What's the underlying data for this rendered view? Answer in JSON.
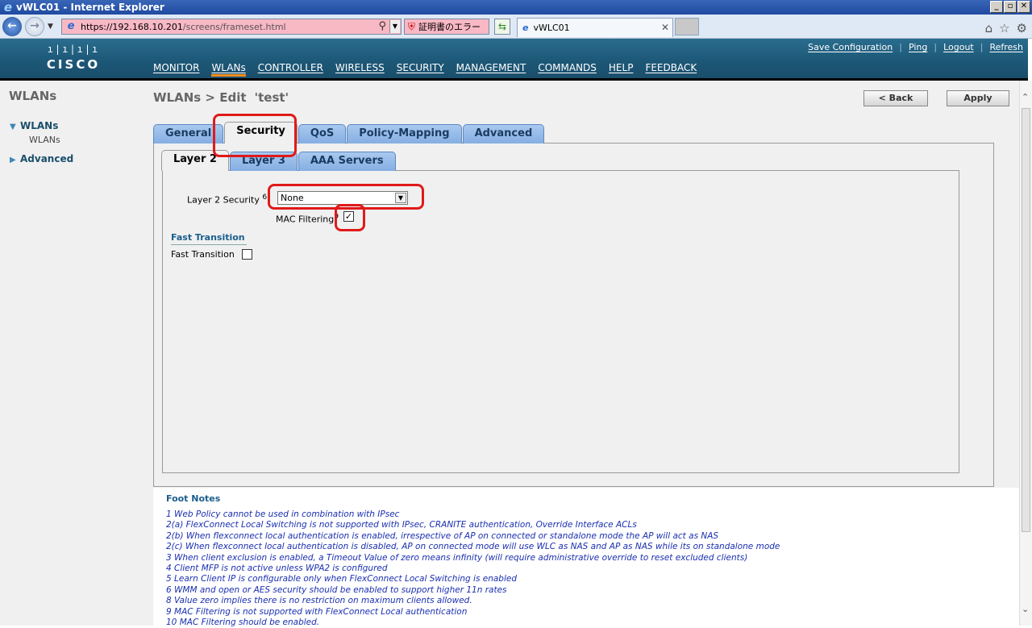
{
  "browser": {
    "title": "vWLC01 - Internet Explorer",
    "url_host": "https://192.168.10.201",
    "url_path": "/screens/frameset.html",
    "cert_error": "証明書のエラー",
    "tab_title": "vWLC01",
    "window_buttons": [
      "_",
      "▫",
      "✕"
    ]
  },
  "header": {
    "logo_text": "CISCO",
    "top_links": [
      "Save Configuration",
      "Ping",
      "Logout",
      "Refresh"
    ],
    "nav": [
      "MONITOR",
      "WLANs",
      "CONTROLLER",
      "WIRELESS",
      "SECURITY",
      "MANAGEMENT",
      "COMMANDS",
      "HELP",
      "FEEDBACK"
    ],
    "active_nav": "WLANs"
  },
  "sidebar": {
    "heading": "WLANs",
    "group1": "WLANs",
    "group1_item": "WLANs",
    "group2": "Advanced"
  },
  "main": {
    "breadcrumb": "WLANs > Edit",
    "wlan_name": "'test'",
    "back_label": "< Back",
    "apply_label": "Apply",
    "tabs": [
      "General",
      "Security",
      "QoS",
      "Policy-Mapping",
      "Advanced"
    ],
    "active_tab": "Security",
    "subtabs": [
      "Layer 2",
      "Layer 3",
      "AAA Servers"
    ],
    "active_subtab": "Layer 2",
    "layer2_security_label": "Layer 2 Security",
    "layer2_security_suffix": "6",
    "layer2_security_value": "None",
    "mac_filtering_label": "MAC Filtering",
    "mac_filtering_suffix": "9",
    "mac_filtering_checked": true,
    "fast_transition_heading": "Fast Transition",
    "fast_transition_label": "Fast Transition",
    "fast_transition_checked": false
  },
  "footnotes": {
    "heading": "Foot Notes",
    "items": [
      "1 Web Policy cannot be used in combination with IPsec",
      "2(a) FlexConnect Local Switching is not supported with IPsec, CRANITE authentication, Override Interface ACLs",
      "2(b) When flexconnect local authentication is enabled, irrespective of AP on connected or standalone mode the AP will act as NAS",
      "2(c) When flexconnect local authentication is disabled, AP on connected mode will use WLC as NAS and AP as NAS while its on standalone mode",
      "3 When client exclusion is enabled, a Timeout Value of zero means infinity (will require administrative override to reset excluded clients)",
      "4 Client MFP is not active unless WPA2 is configured",
      "5 Learn Client IP is configurable only when FlexConnect Local Switching is enabled",
      "6 WMM and open or AES security should be enabled to support higher 11n rates",
      "8 Value zero implies there is no restriction on maximum clients allowed.",
      "9 MAC Filtering is not supported with FlexConnect Local authentication",
      "10 MAC Filtering should be enabled."
    ]
  },
  "colors": {
    "header_bg": "#1d5878",
    "active_nav_underline": "#f28c1e",
    "tab_blue": "#85aee2",
    "annotation_red": "#e01a1a",
    "footnote_text": "#1a2fb0"
  }
}
